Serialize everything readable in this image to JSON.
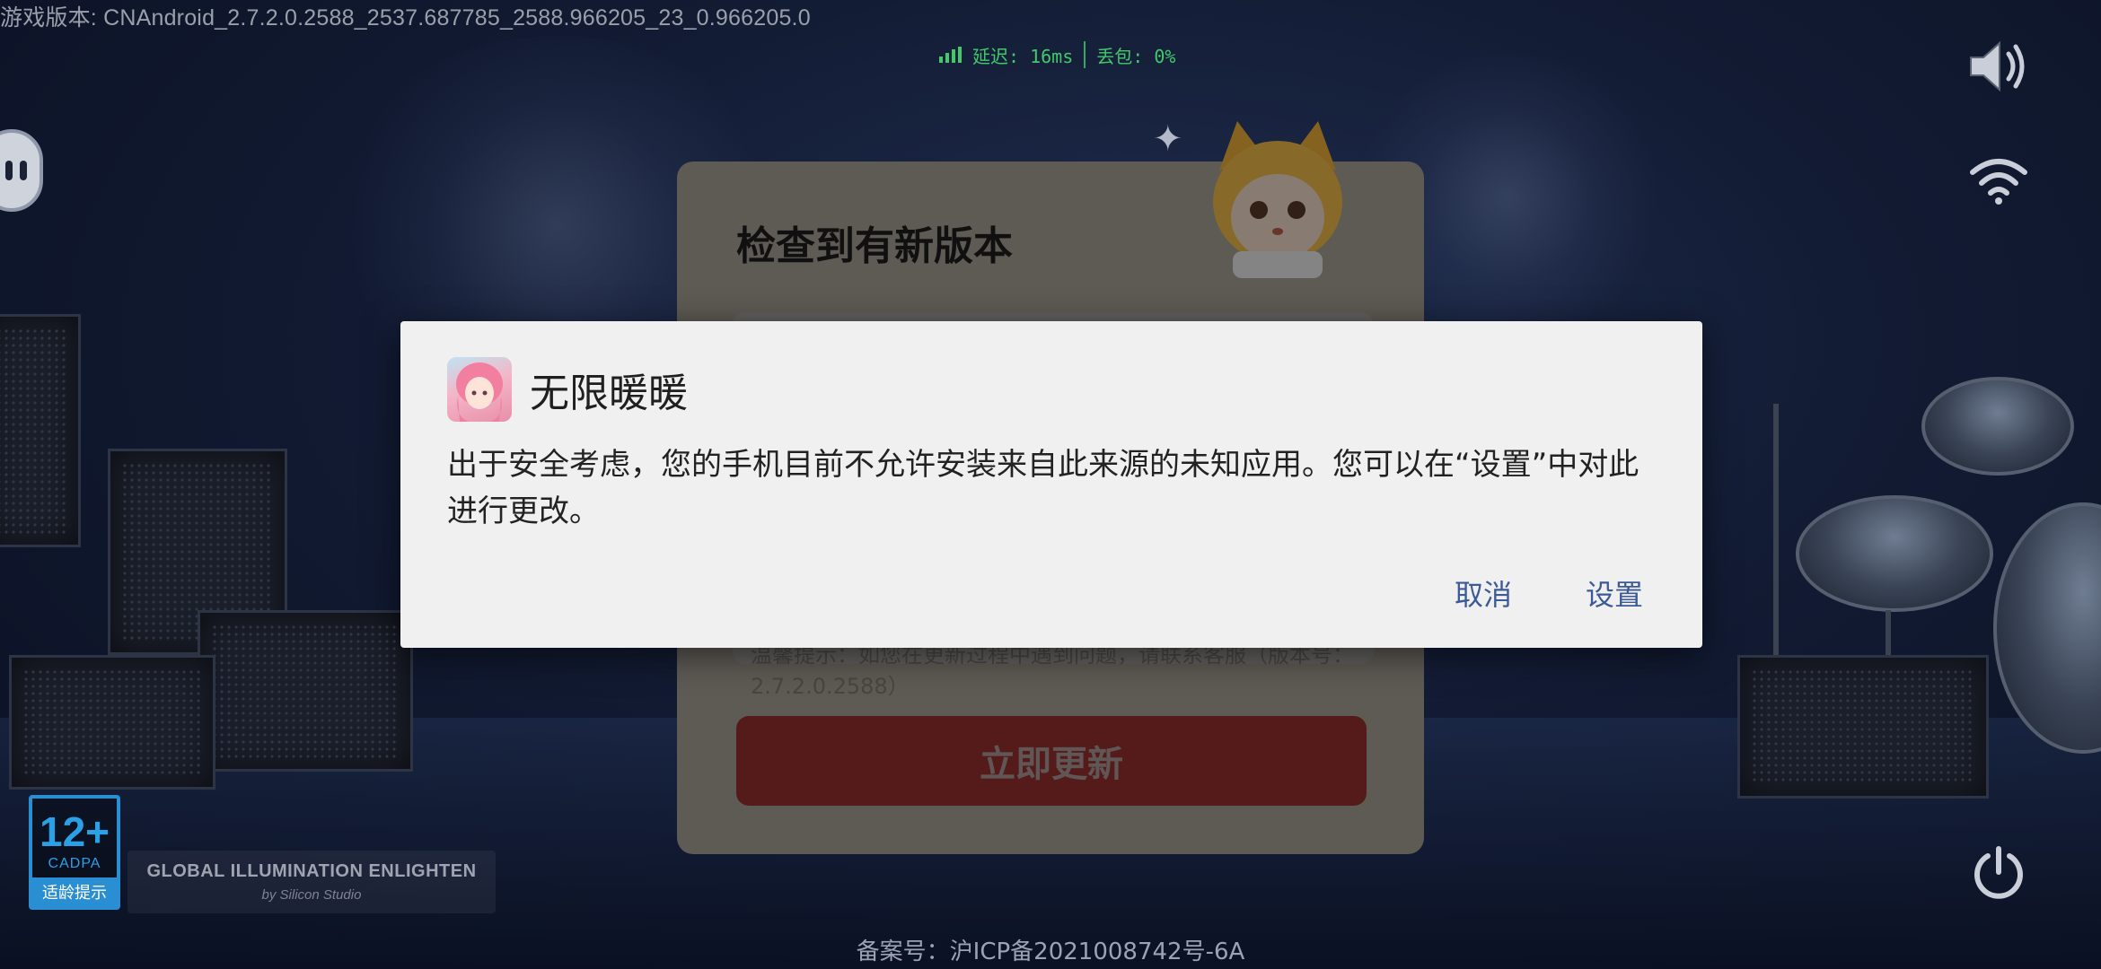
{
  "hud": {
    "version_text": "游戏版本: CNAndroid_2.7.2.0.2588_2537.687785_2588.966205_23_0.966205.0",
    "latency_text": "延迟: 16ms",
    "packet_loss_text": "丢包: 0%",
    "status_color": "#41c96a"
  },
  "side_icons": {
    "volume": "volume-icon",
    "wifi": "wifi-icon",
    "power": "power-icon",
    "chat": "chat-bubble-icon"
  },
  "update_panel": {
    "title": "检查到有新版本",
    "note": "温馨提示：如您在更新过程中遇到问题，请联系客服（版本号：2.7.2.0.2588）",
    "button_label": "立即更新"
  },
  "footer": {
    "age_number": "12+",
    "age_org": "CADPA",
    "age_label": "适龄提示",
    "gi_title": "GLOBAL ILLUMINATION ENLIGHTEN",
    "gi_sub": "by Silicon Studio",
    "icp": "备案号：沪ICP备2021008742号-6A"
  },
  "dialog": {
    "app_name": "无限暖暖",
    "message": "出于安全考虑，您的手机目前不允许安装来自此来源的未知应用。您可以在“设置”中对此进行更改。",
    "cancel_label": "取消",
    "settings_label": "设置",
    "accent_color": "#3c5a96"
  }
}
